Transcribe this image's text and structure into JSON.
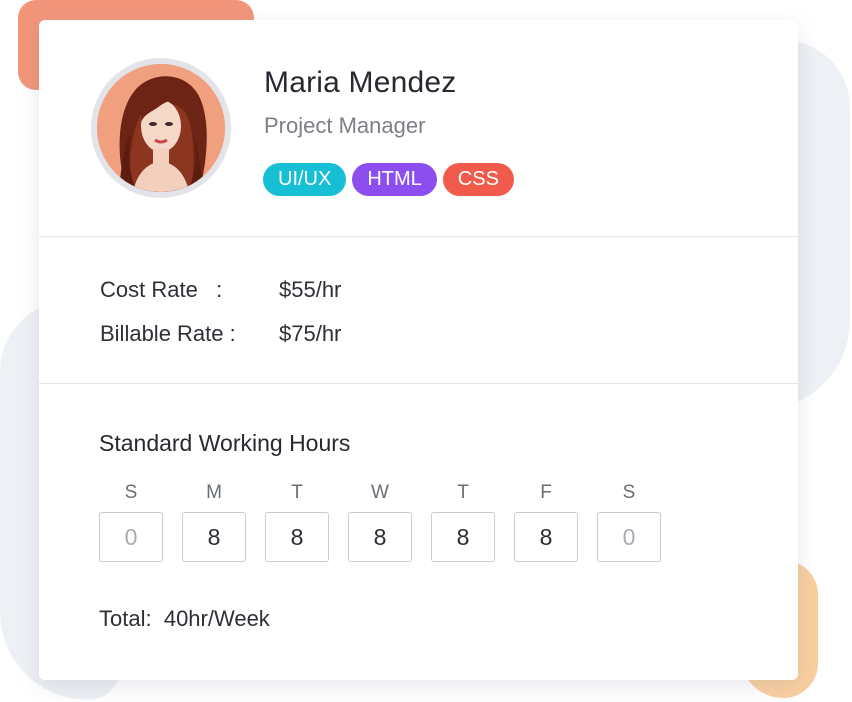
{
  "profile": {
    "name": "Maria Mendez",
    "role": "Project Manager",
    "tags": [
      {
        "label": "UI/UX",
        "color": "#16bfd3"
      },
      {
        "label": "HTML",
        "color": "#8d4ef0"
      },
      {
        "label": "CSS",
        "color": "#f15b4b"
      }
    ]
  },
  "rates": {
    "cost_label": "Cost Rate   :",
    "cost_value": "$55/hr",
    "billable_label": "Billable Rate :",
    "billable_value": "$75/hr"
  },
  "hours": {
    "title": "Standard Working Hours",
    "days": [
      {
        "letter": "S",
        "value": "0"
      },
      {
        "letter": "M",
        "value": "8"
      },
      {
        "letter": "T",
        "value": "8"
      },
      {
        "letter": "W",
        "value": "8"
      },
      {
        "letter": "T",
        "value": "8"
      },
      {
        "letter": "F",
        "value": "8"
      },
      {
        "letter": "S",
        "value": "0"
      }
    ],
    "total_label": "Total:",
    "total_value": "40hr/Week"
  },
  "colors": {
    "blob_orange": "#f3957a",
    "blob_peach": "#f9cf9f",
    "blob_grey": "#edf0f4"
  }
}
